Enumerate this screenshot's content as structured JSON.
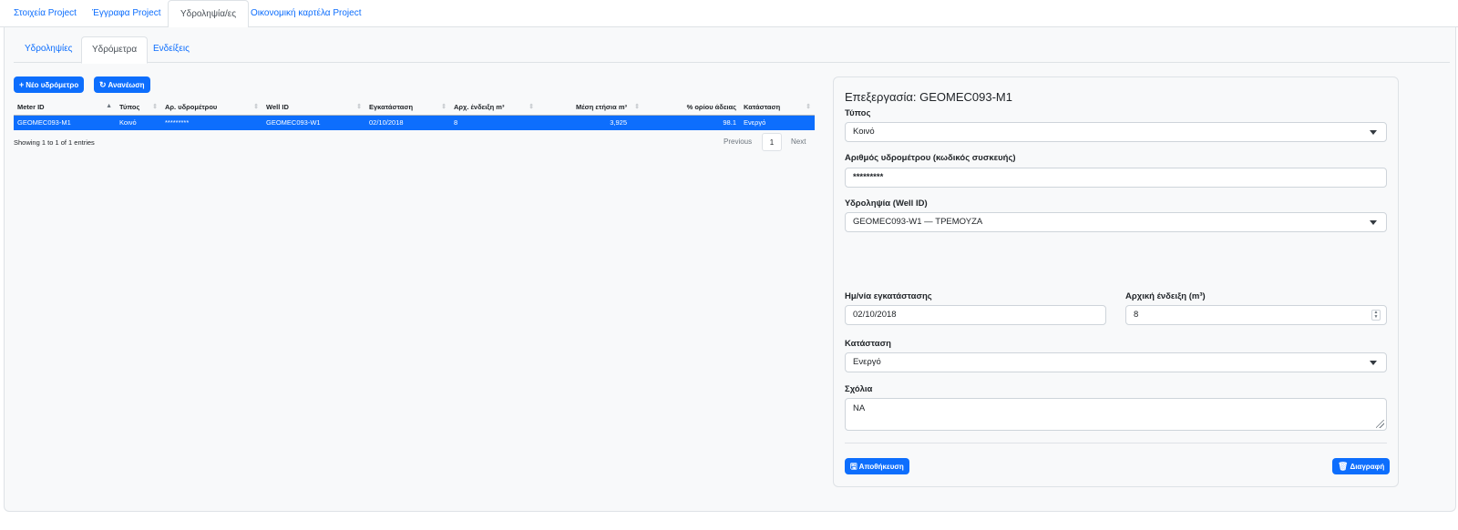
{
  "top_tabs": [
    "Στοιχεία Project",
    "Έγγραφα Project",
    "Υδροληψία/ες",
    "Οικονομική καρτέλα Project"
  ],
  "sub_tabs": [
    "Υδροληψίες",
    "Υδρόμετρα",
    "Ενδείξεις"
  ],
  "toolbar": {
    "new_label": "Νέο υδρόμετρο",
    "refresh_label": "Ανανέωση",
    "new_icon": "plus-icon",
    "refresh_icon": "refresh-icon"
  },
  "table": {
    "headers": [
      "Meter ID",
      "Τύπος",
      "Αρ. υδρομέτρου",
      "Well ID",
      "Εγκατάσταση",
      "Αρχ. ένδειξη m³",
      "Μέση ετήσια m³",
      "% ορίου άδειας",
      "Κατάσταση"
    ],
    "rows": [
      [
        "GEOMEC093-M1",
        "Κοινό",
        "*********",
        "GEOMEC093-W1",
        "02/10/2018",
        "8",
        "3,925",
        "98.1",
        "Ενεργό"
      ]
    ],
    "selected_color": "#0d6efd"
  },
  "pagination": {
    "info": "Showing 1 to 1 of 1 entries",
    "previous": "Previous",
    "page": "1",
    "next": "Next"
  },
  "edit": {
    "title": "Επεξεργασία: GEOMEC093-M1",
    "type_label": "Τύπος",
    "type_value": "Κοινό",
    "meter_no_label": "Αριθμός υδρομέτρου (κωδικός συσκευής)",
    "meter_no_value": "*********",
    "well_label": "Υδροληψία (Well ID)",
    "well_value": "GEOMEC093-W1 — ΤΡΕΜΟΥΖΑ",
    "install_date_label": "Ημ/νία εγκατάστασης",
    "install_date_value": "02/10/2018",
    "initial_reading_label": "Αρχική ένδειξη (m³)",
    "initial_reading_value": "8",
    "status_label": "Κατάσταση",
    "status_value": "Ενεργό",
    "comments_label": "Σχόλια",
    "comments_value": "NA",
    "save_label": "Αποθήκευση",
    "delete_label": "Διαγραφή"
  },
  "accent_color": "#0d6efd"
}
